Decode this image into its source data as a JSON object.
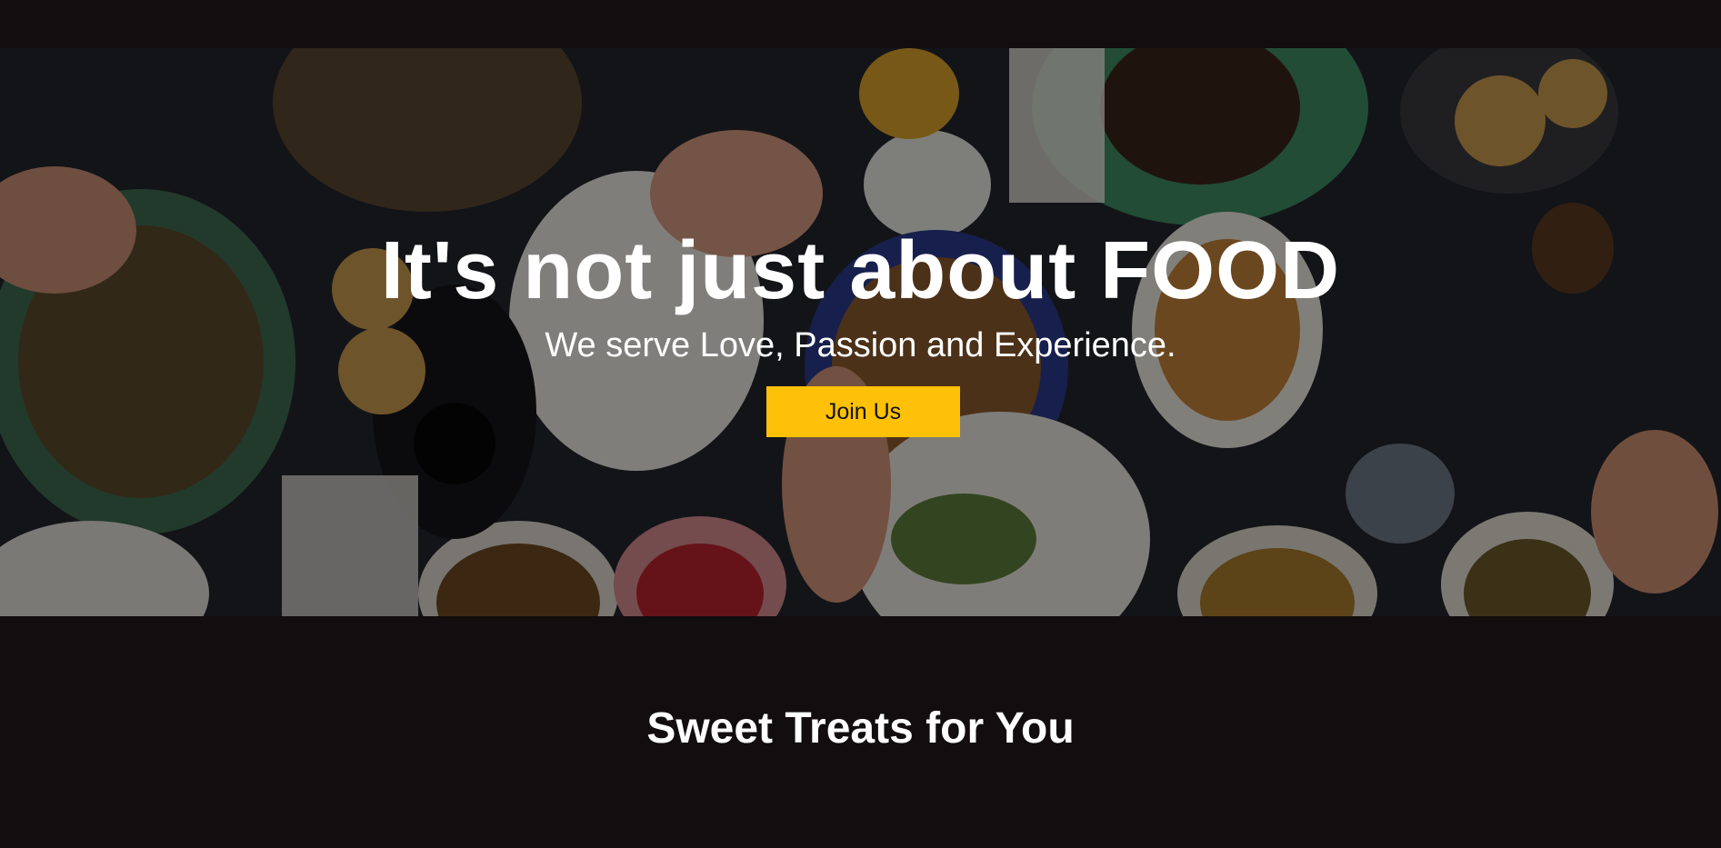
{
  "hero": {
    "background_image": "food-table-photo",
    "title": "It's not just about FOOD",
    "subtitle": "We serve Love, Passion and Experience.",
    "cta_label": "Join Us",
    "cta_color": "#ffc107"
  },
  "section": {
    "title": "Sweet Treats for You"
  },
  "colors": {
    "page_background": "#120d0e",
    "text": "#ffffff"
  }
}
